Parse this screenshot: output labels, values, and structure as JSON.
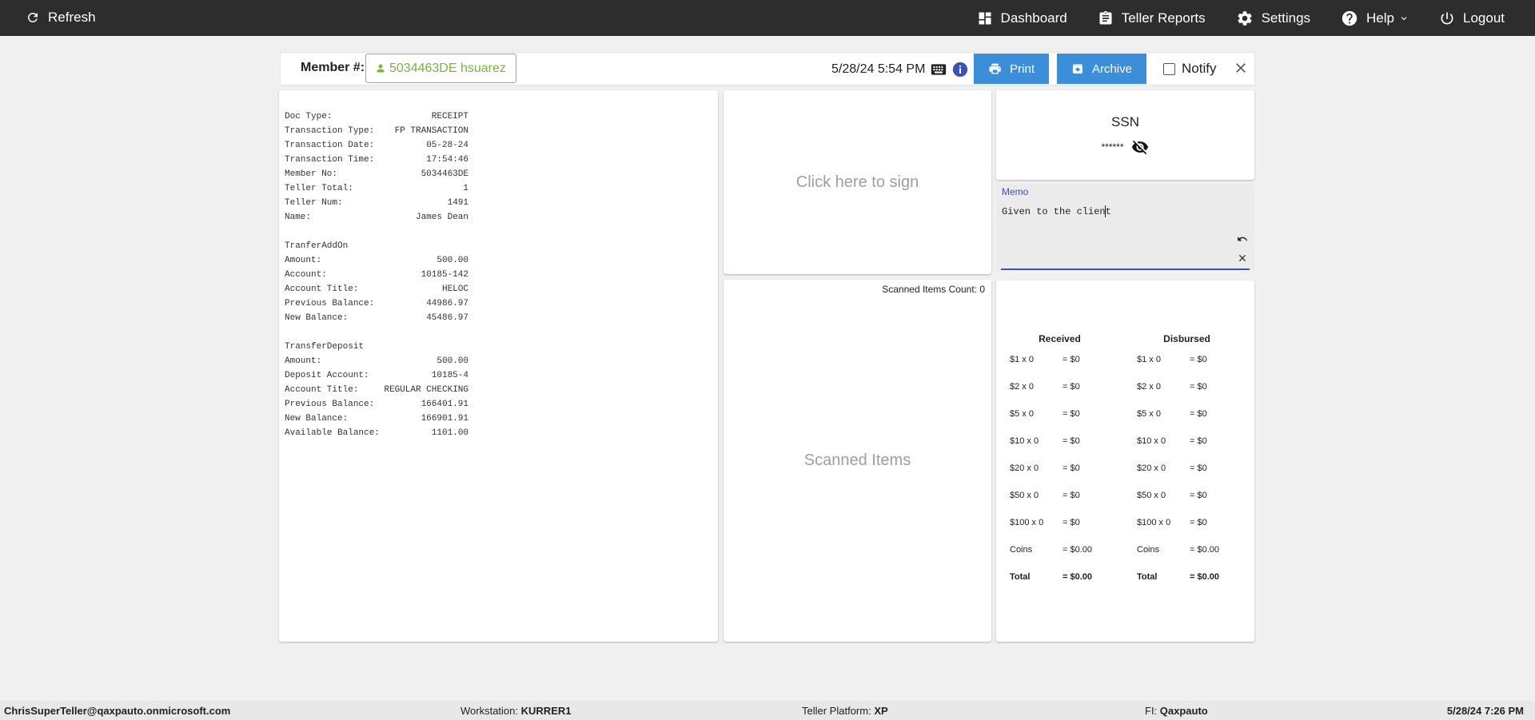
{
  "nav": {
    "refresh": "Refresh",
    "dashboard": "Dashboard",
    "teller_reports": "Teller Reports",
    "settings": "Settings",
    "help": "Help",
    "logout": "Logout"
  },
  "header": {
    "member_label": "Member #:",
    "member_chip": "5034463DE hsuarez",
    "datetime": "5/28/24 5:54 PM",
    "print": "Print",
    "archive": "Archive",
    "notify": "Notify"
  },
  "receipt": {
    "top": [
      {
        "k": "Doc Type:",
        "v": "RECEIPT"
      },
      {
        "k": "Transaction Type:",
        "v": "FP TRANSACTION"
      },
      {
        "k": "Transaction Date:",
        "v": "05-28-24"
      },
      {
        "k": "Transaction Time:",
        "v": "17:54:46"
      },
      {
        "k": "Member No:",
        "v": "5034463DE"
      },
      {
        "k": "Teller Total:",
        "v": "1"
      },
      {
        "k": "Teller Num:",
        "v": "1491"
      },
      {
        "k": "Name:",
        "v": "James Dean"
      }
    ],
    "section1_title": "TranferAddOn",
    "section1": [
      {
        "k": "Amount:",
        "v": "500.00"
      },
      {
        "k": "Account:",
        "v": "10185-142"
      },
      {
        "k": "Account Title:",
        "v": "HELOC"
      },
      {
        "k": "Previous Balance:",
        "v": "44986.97"
      },
      {
        "k": "New Balance:",
        "v": "45486.97"
      }
    ],
    "section2_title": "TransferDeposit",
    "section2": [
      {
        "k": "Amount:",
        "v": "500.00"
      },
      {
        "k": "Deposit Account:",
        "v": "10185-4"
      },
      {
        "k": "Account Title:",
        "v": "REGULAR CHECKING"
      },
      {
        "k": "Previous Balance:",
        "v": "166401.91"
      },
      {
        "k": "New Balance:",
        "v": "166901.91"
      },
      {
        "k": "Available Balance:",
        "v": "1101.00"
      }
    ]
  },
  "sign": {
    "label": "Click here to sign"
  },
  "scanned": {
    "count": "Scanned Items Count: 0",
    "label": "Scanned Items"
  },
  "ssn": {
    "title": "SSN",
    "masked": "******"
  },
  "memo": {
    "label": "Memo",
    "value": "Given to the client"
  },
  "cash": {
    "received_title": "Received",
    "disbursed_title": "Disbursed",
    "received": [
      {
        "d": "$1 x 0",
        "e": "= $0"
      },
      {
        "d": "$2 x 0",
        "e": "= $0"
      },
      {
        "d": "$5 x 0",
        "e": "= $0"
      },
      {
        "d": "$10 x 0",
        "e": "= $0"
      },
      {
        "d": "$20 x 0",
        "e": "= $0"
      },
      {
        "d": "$50 x 0",
        "e": "= $0"
      },
      {
        "d": "$100 x 0",
        "e": "= $0"
      },
      {
        "d": "Coins",
        "e": "= $0.00"
      }
    ],
    "disbursed": [
      {
        "d": "$1 x 0",
        "e": "= $0"
      },
      {
        "d": "$2 x 0",
        "e": "= $0"
      },
      {
        "d": "$5 x 0",
        "e": "= $0"
      },
      {
        "d": "$10 x 0",
        "e": "= $0"
      },
      {
        "d": "$20 x 0",
        "e": "= $0"
      },
      {
        "d": "$50 x 0",
        "e": "= $0"
      },
      {
        "d": "$100 x 0",
        "e": "= $0"
      },
      {
        "d": "Coins",
        "e": "= $0.00"
      }
    ],
    "received_total": {
      "d": "Total",
      "e": "= $0.00"
    },
    "disbursed_total": {
      "d": "Total",
      "e": "= $0.00"
    }
  },
  "footer": {
    "user": "ChrisSuperTeller@qaxpauto.onmicrosoft.com",
    "workstation_label": "Workstation:",
    "workstation": "KURRER1",
    "platform_label": "Teller Platform:",
    "platform": "XP",
    "fi_label": "FI:",
    "fi": "Qaxpauto",
    "datetime": "5/28/24 7:26 PM"
  }
}
